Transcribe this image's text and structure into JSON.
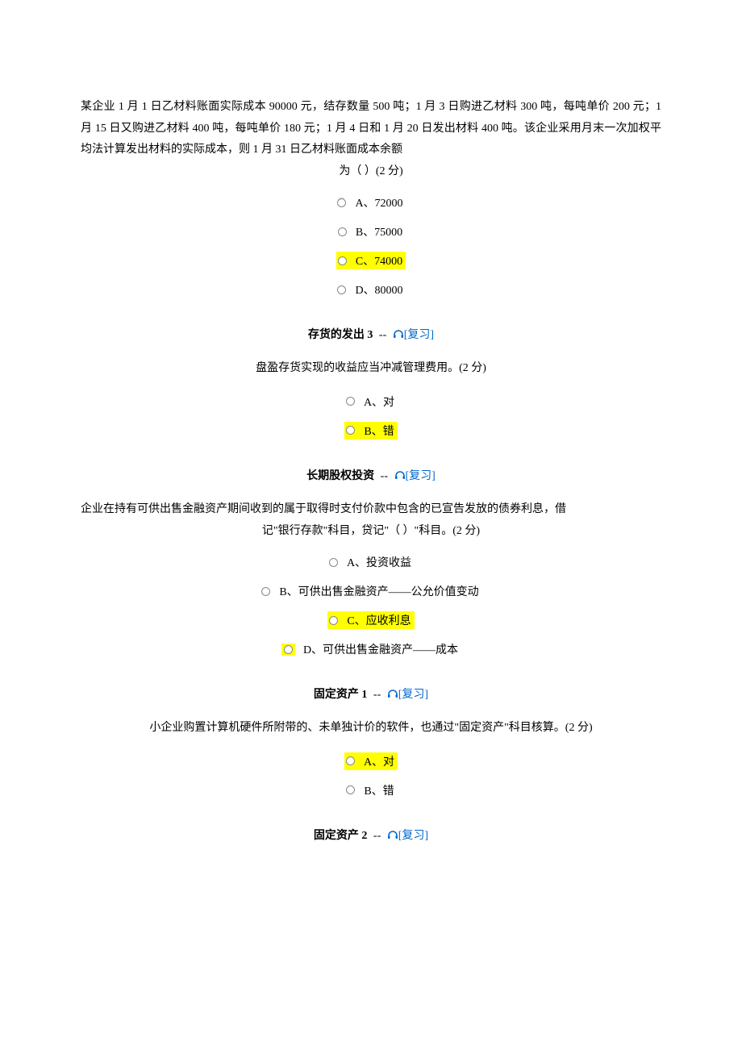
{
  "q1": {
    "text_lines": [
      "某企业 1 月 1 日乙材料账面实际成本 90000 元，结存数量 500 吨；1 月 3 日购进乙材料 300 吨，每吨单价 200 元；1 月 15 日又购进乙材料 400 吨，每吨单价 180 元；1 月 4 日和 1 月 20 日发出材料 400 吨。该企业采用月末一次加权平均法计算发出材料的实际成本，则 1 月 31 日乙材料账面成本余额"
    ],
    "last_line": "为（ ）(2 分)",
    "options": [
      {
        "label": "A、72000",
        "highlight": false
      },
      {
        "label": "B、75000",
        "highlight": false
      },
      {
        "label": "C、74000",
        "highlight": true
      },
      {
        "label": "D、80000",
        "highlight": false
      }
    ]
  },
  "s2": {
    "title": "存货的发出 3",
    "link": "[复习]"
  },
  "q2": {
    "text": "盘盈存货实现的收益应当冲减管理费用。(2 分)",
    "options": [
      {
        "label": "A、对",
        "highlight": false
      },
      {
        "label": "B、错",
        "highlight": true
      }
    ]
  },
  "s3": {
    "title": "长期股权投资",
    "link": "[复习]"
  },
  "q3": {
    "text_lines": [
      "企业在持有可供出售金融资产期间收到的属于取得时支付价款中包含的已宣告发放的债券利息，借"
    ],
    "last_line": "记\"银行存款\"科目，贷记\"（ ）\"科目。(2 分)",
    "options": [
      {
        "label": "A、投资收益",
        "highlight": false,
        "radio_highlight": false
      },
      {
        "label": "B、可供出售金融资产——公允价值变动",
        "highlight": false,
        "radio_highlight": false
      },
      {
        "label": "C、应收利息",
        "highlight": true,
        "radio_highlight": false
      },
      {
        "label": "D、可供出售金融资产——成本",
        "highlight": false,
        "radio_highlight": true
      }
    ]
  },
  "s4": {
    "title": "固定资产 1",
    "link": "[复习]"
  },
  "q4": {
    "text": "小企业购置计算机硬件所附带的、未单独计价的软件，也通过\"固定资产\"科目核算。(2 分)",
    "options": [
      {
        "label": "A、对",
        "highlight": true
      },
      {
        "label": "B、错",
        "highlight": false
      }
    ]
  },
  "s5": {
    "title": "固定资产 2",
    "link": "[复习]"
  }
}
